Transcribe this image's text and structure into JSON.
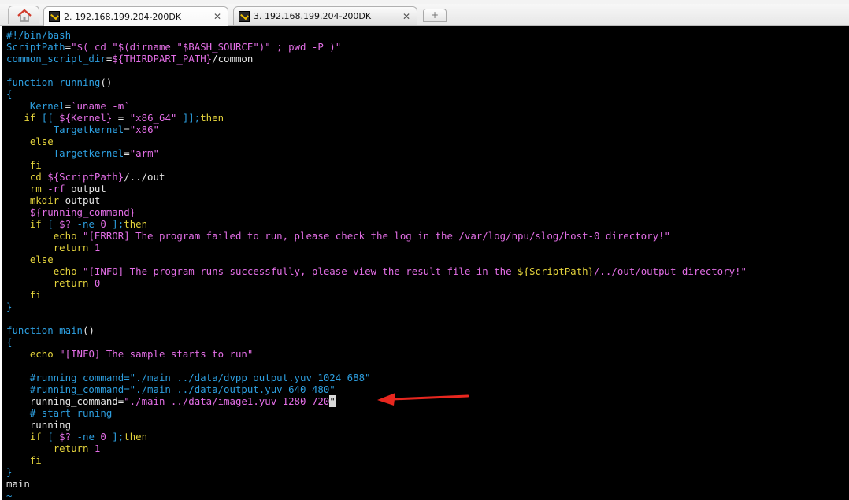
{
  "tabs": {
    "home_tab": "home",
    "tab1_label": "2. 192.168.199.204-200DK",
    "tab2_label": "3. 192.168.199.204-200DK",
    "close_symbol": "✕",
    "new_tab_symbol": "+"
  },
  "colors": {
    "background": "#000000",
    "keyword_blue": "#2d9fe0",
    "string_magenta": "#e36ee6",
    "bracket_yellow": "#e3d23c",
    "annotation_arrow": "#e8271f"
  },
  "code": {
    "l1_shebang": "#!/bin/bash",
    "l2_var": "ScriptPath",
    "l2_eq": "=",
    "l2_str": "\"$( cd \"$(dirname \"$BASH_SOURCE\")\" ; pwd -P )\"",
    "l3_var": "common_script_dir",
    "l3_eq": "=",
    "l3_ref": "${THIRDPART_PATH}",
    "l3_rest": "/common",
    "l5_kw": "function",
    "l5_name": " running",
    "l5_paren": "()",
    "l6_brace": "{",
    "l7_indent": "    ",
    "l7_var": "Kernel",
    "l7_eq": "=",
    "l7_cmd": "`uname -m`",
    "l8_indent": "   ",
    "l8_kw": "if",
    "l8_open": " [[ ",
    "l8_ref": "${Kernel}",
    "l8_eq": " = ",
    "l8_str": "\"x86_64\"",
    "l8_close": " ]];",
    "l8_then": "then",
    "l9_indent": "        ",
    "l9_var": "Targetkernel",
    "l9_eq": "=",
    "l9_str": "\"x86\"",
    "l10_indent": "    ",
    "l10_kw": "else",
    "l11_indent": "        ",
    "l11_var": "Targetkernel",
    "l11_eq": "=",
    "l11_str": "\"arm\"",
    "l12_indent": "    ",
    "l12_kw": "fi",
    "l13_indent": "    ",
    "l13_kw": "cd",
    "l13_sp": " ",
    "l13_ref": "${ScriptPath}",
    "l13_rest": "/../out",
    "l14_indent": "    ",
    "l14_kw": "rm",
    "l14_flag": " -rf",
    "l14_rest": " output",
    "l15_indent": "    ",
    "l15_kw": "mkdir",
    "l15_rest": " output",
    "l16_indent": "    ",
    "l16_ref": "${running_command}",
    "l17_indent": "    ",
    "l17_kw": "if",
    "l17_open": " [ ",
    "l17_ref": "$?",
    "l17_flag": " -ne",
    "l17_num": " 0",
    "l17_close": " ];",
    "l17_then": "then",
    "l18_indent": "        ",
    "l18_kw": "echo",
    "l18_sp": " ",
    "l18_str": "\"[ERROR] The program failed to run, please check the log in the /var/log/npu/slog/host-0 directory!\"",
    "l19_indent": "        ",
    "l19_kw": "return",
    "l19_num": " 1",
    "l20_indent": "    ",
    "l20_kw": "else",
    "l21_indent": "        ",
    "l21_kw": "echo",
    "l21_sp": " ",
    "l21_str_a": "\"[INFO] The program runs successfully, please view the result file in the ",
    "l21_ref": "${ScriptPath}",
    "l21_str_b": "/../out/output directory!\"",
    "l22_indent": "        ",
    "l22_kw": "return",
    "l22_num": " 0",
    "l23_indent": "    ",
    "l23_kw": "fi",
    "l24_brace": "}",
    "l26_kw": "function",
    "l26_name": " main",
    "l26_paren": "()",
    "l27_brace": "{",
    "l28_indent": "    ",
    "l28_kw": "echo",
    "l28_sp": " ",
    "l28_str": "\"[INFO] The sample starts to run\"",
    "l30_comment": "    #running_command=\"./main ../data/dvpp_output.yuv 1024 688\"",
    "l31_comment": "    #running_command=\"./main ../data/output.yuv 640 480\"",
    "l32_indent": "    ",
    "l32_var": "running_command",
    "l32_eq": "=",
    "l32_str": "\"./main ../data/image1.yuv 1280 720",
    "l32_cursor": "\"",
    "l33_comment": "    # start runing",
    "l34_text": "    running",
    "l35_indent": "    ",
    "l35_kw": "if",
    "l35_open": " [ ",
    "l35_ref": "$?",
    "l35_flag": " -ne",
    "l35_num": " 0",
    "l35_close": " ];",
    "l35_then": "then",
    "l36_indent": "        ",
    "l36_kw": "return",
    "l36_num": " 1",
    "l37_indent": "    ",
    "l37_kw": "fi",
    "l38_brace": "}",
    "l39_text": "main",
    "l40_tilde": "~"
  }
}
